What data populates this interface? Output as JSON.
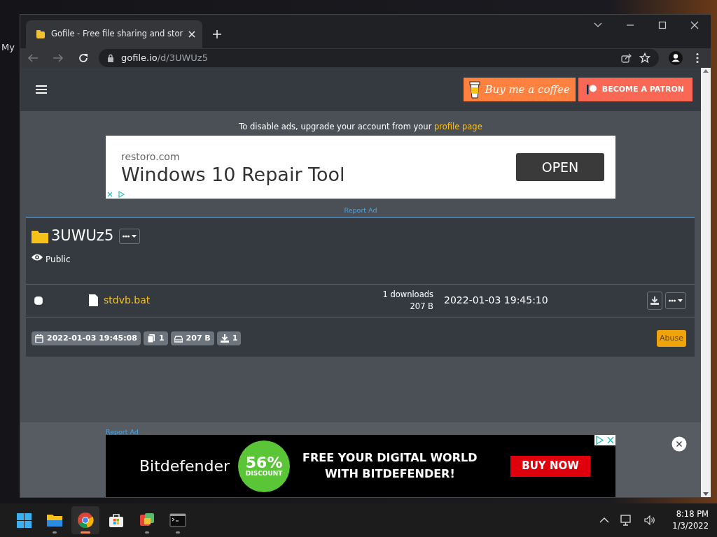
{
  "desktop": {
    "label": "My"
  },
  "browser": {
    "tab_title": "Gofile - Free file sharing and stor",
    "url_host": "gofile.io",
    "url_path": "/d/3UWUz5"
  },
  "header": {
    "coffee_button": "Buy me a coffee",
    "patron_button": "BECOME A PATRON"
  },
  "ad_notice": {
    "text": "To disable ads, upgrade your account from your ",
    "link": "profile page"
  },
  "top_ad": {
    "domain": "restoro.com",
    "headline": "Windows 10 Repair Tool",
    "button": "OPEN",
    "report": "Report Ad"
  },
  "folder": {
    "name": "3UWUz5",
    "visibility": "Public"
  },
  "files": [
    {
      "checked": false,
      "name": "stdvb.bat",
      "downloads": "1 downloads",
      "size": "207 B",
      "date": "2022-01-03 19:45:10"
    }
  ],
  "stats": [
    {
      "kind": "date",
      "text": "2022-01-03 19:45:08"
    },
    {
      "kind": "files",
      "text": "1"
    },
    {
      "kind": "size",
      "text": "207 B"
    },
    {
      "kind": "downloads",
      "text": "1"
    }
  ],
  "abuse_button": "Abuse",
  "bottom_ad": {
    "report": "Report Ad",
    "brand": "Bitdefender",
    "discount_value": "56%",
    "discount_label": "DISCOUNT",
    "headline": [
      "FREE YOUR DIGITAL WORLD",
      "WITH BITDEFENDER!"
    ],
    "button": "BUY NOW"
  },
  "taskbar": {
    "apps": [
      {
        "kind": "start",
        "running": false,
        "active": false
      },
      {
        "kind": "explorer",
        "running": true,
        "active": false
      },
      {
        "kind": "chrome",
        "running": true,
        "active": true
      },
      {
        "kind": "store",
        "running": false,
        "active": false
      },
      {
        "kind": "paint",
        "running": true,
        "active": false
      },
      {
        "kind": "terminal",
        "running": true,
        "active": false
      }
    ],
    "time": "8:18 PM",
    "date": "1/3/2022"
  }
}
